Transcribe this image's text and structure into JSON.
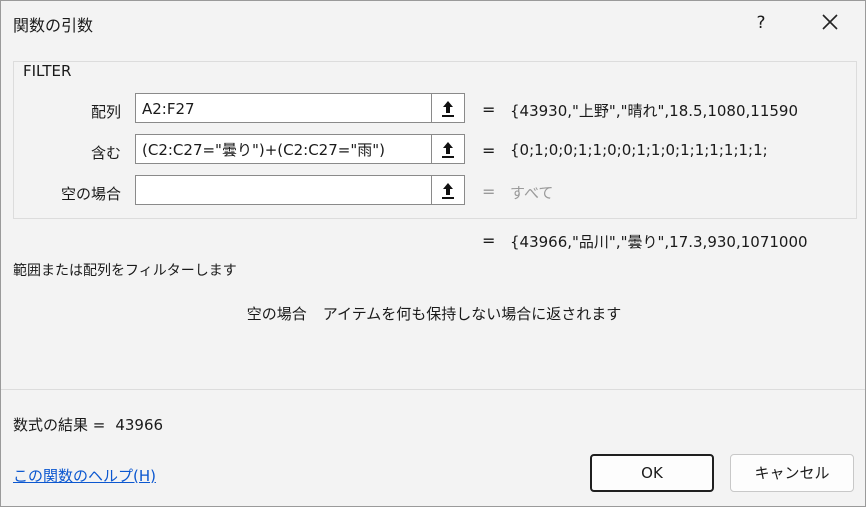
{
  "dialog": {
    "title": "関数の引数",
    "help_glyph": "?",
    "function_name": "FILTER"
  },
  "arguments": [
    {
      "label": "配列",
      "value": "A2:F27",
      "evaluated": "{43930,\"上野\",\"晴れ\",18.5,1080,11590"
    },
    {
      "label": "含む",
      "value": "(C2:C27=\"曇り\")+(C2:C27=\"雨\")",
      "evaluated": "{0;1;0;0;1;1;0;0;1;1;0;1;1;1;1;1;1;"
    },
    {
      "label": "空の場合",
      "value": "",
      "evaluated": "すべて"
    }
  ],
  "equals_sign": "=",
  "function_result_preview": "{43966,\"品川\",\"曇り\",17.3,930,1071000",
  "description": "範囲または配列をフィルターします",
  "argument_help": {
    "name": "空の場合",
    "text": "アイテムを何も保持しない場合に返されます"
  },
  "formula_result": {
    "label": "数式の結果 =",
    "value": "43966"
  },
  "help_link": "この関数のヘルプ(H)",
  "buttons": {
    "ok": "OK",
    "cancel": "キャンセル"
  }
}
